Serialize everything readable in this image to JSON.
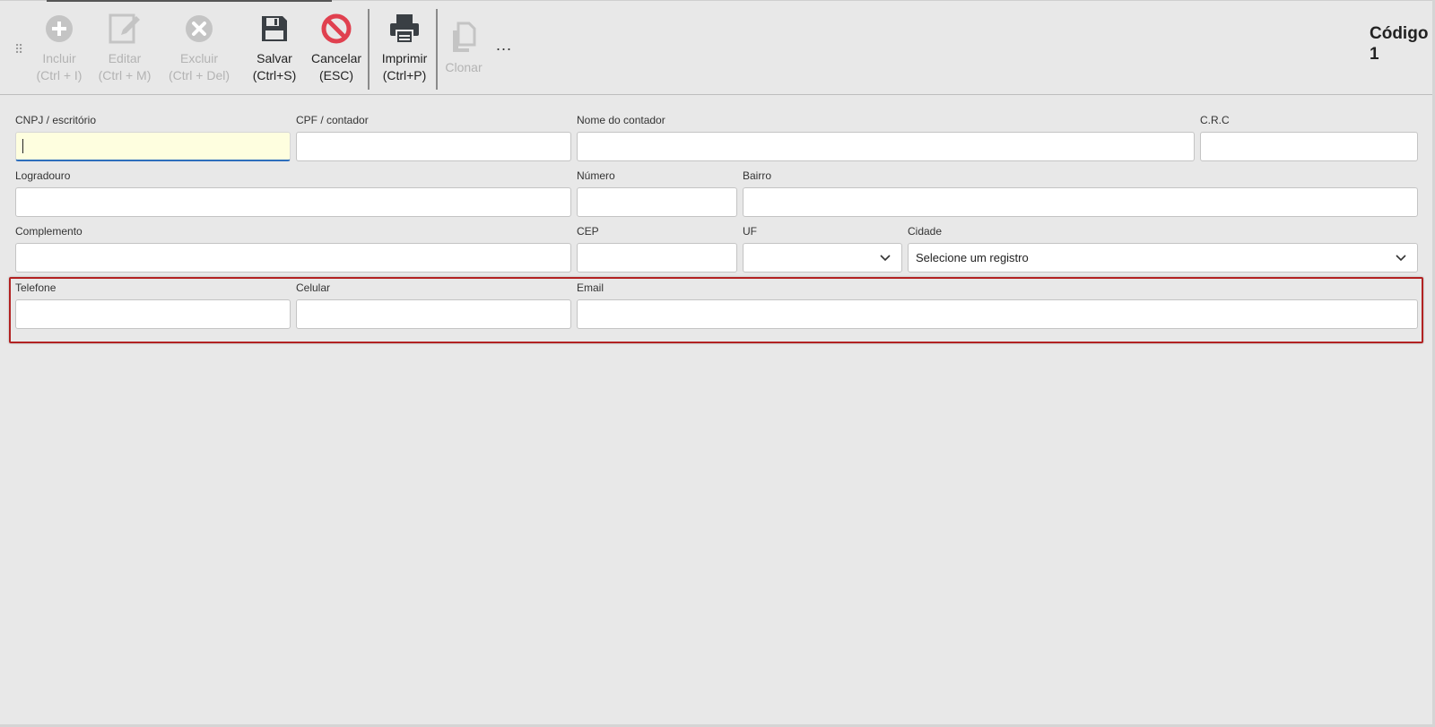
{
  "toolbar": {
    "buttons": [
      {
        "label": "Incluir",
        "shortcut": "(Ctrl + I)",
        "icon": "plus-circle-icon",
        "enabled": false
      },
      {
        "label": "Editar",
        "shortcut": "(Ctrl + M)",
        "icon": "edit-icon",
        "enabled": false
      },
      {
        "label": "Excluir",
        "shortcut": "(Ctrl + Del)",
        "icon": "x-circle-icon",
        "enabled": false
      },
      {
        "label": "Salvar",
        "shortcut": "(Ctrl+S)",
        "icon": "floppy-disk-icon",
        "enabled": true
      },
      {
        "label": "Cancelar",
        "shortcut": "(ESC)",
        "icon": "cancel-icon",
        "enabled": true,
        "color": "#e0404f"
      },
      {
        "label": "Imprimir",
        "shortcut": "(Ctrl+P)",
        "icon": "printer-icon",
        "enabled": true
      },
      {
        "label": "Clonar",
        "icon": "copy-icon",
        "enabled": false
      }
    ],
    "more": "...",
    "codigo_label": "Código",
    "codigo_value": "1"
  },
  "form": {
    "cnpj_label": "CNPJ / escritório",
    "cpf_label": "CPF / contador",
    "nome_label": "Nome do contador",
    "crc_label": "C.R.C",
    "logradouro_label": "Logradouro",
    "numero_label": "Número",
    "bairro_label": "Bairro",
    "complemento_label": "Complemento",
    "cep_label": "CEP",
    "uf_label": "UF",
    "uf_value": "",
    "cidade_label": "Cidade",
    "cidade_value": "Selecione um registro",
    "telefone_label": "Telefone",
    "celular_label": "Celular",
    "email_label": "Email"
  },
  "colors": {
    "highlight": "#b22222",
    "focus_bg": "#fefedf",
    "focus_underline": "#2e6ebc",
    "cancel_red": "#e0404f"
  }
}
